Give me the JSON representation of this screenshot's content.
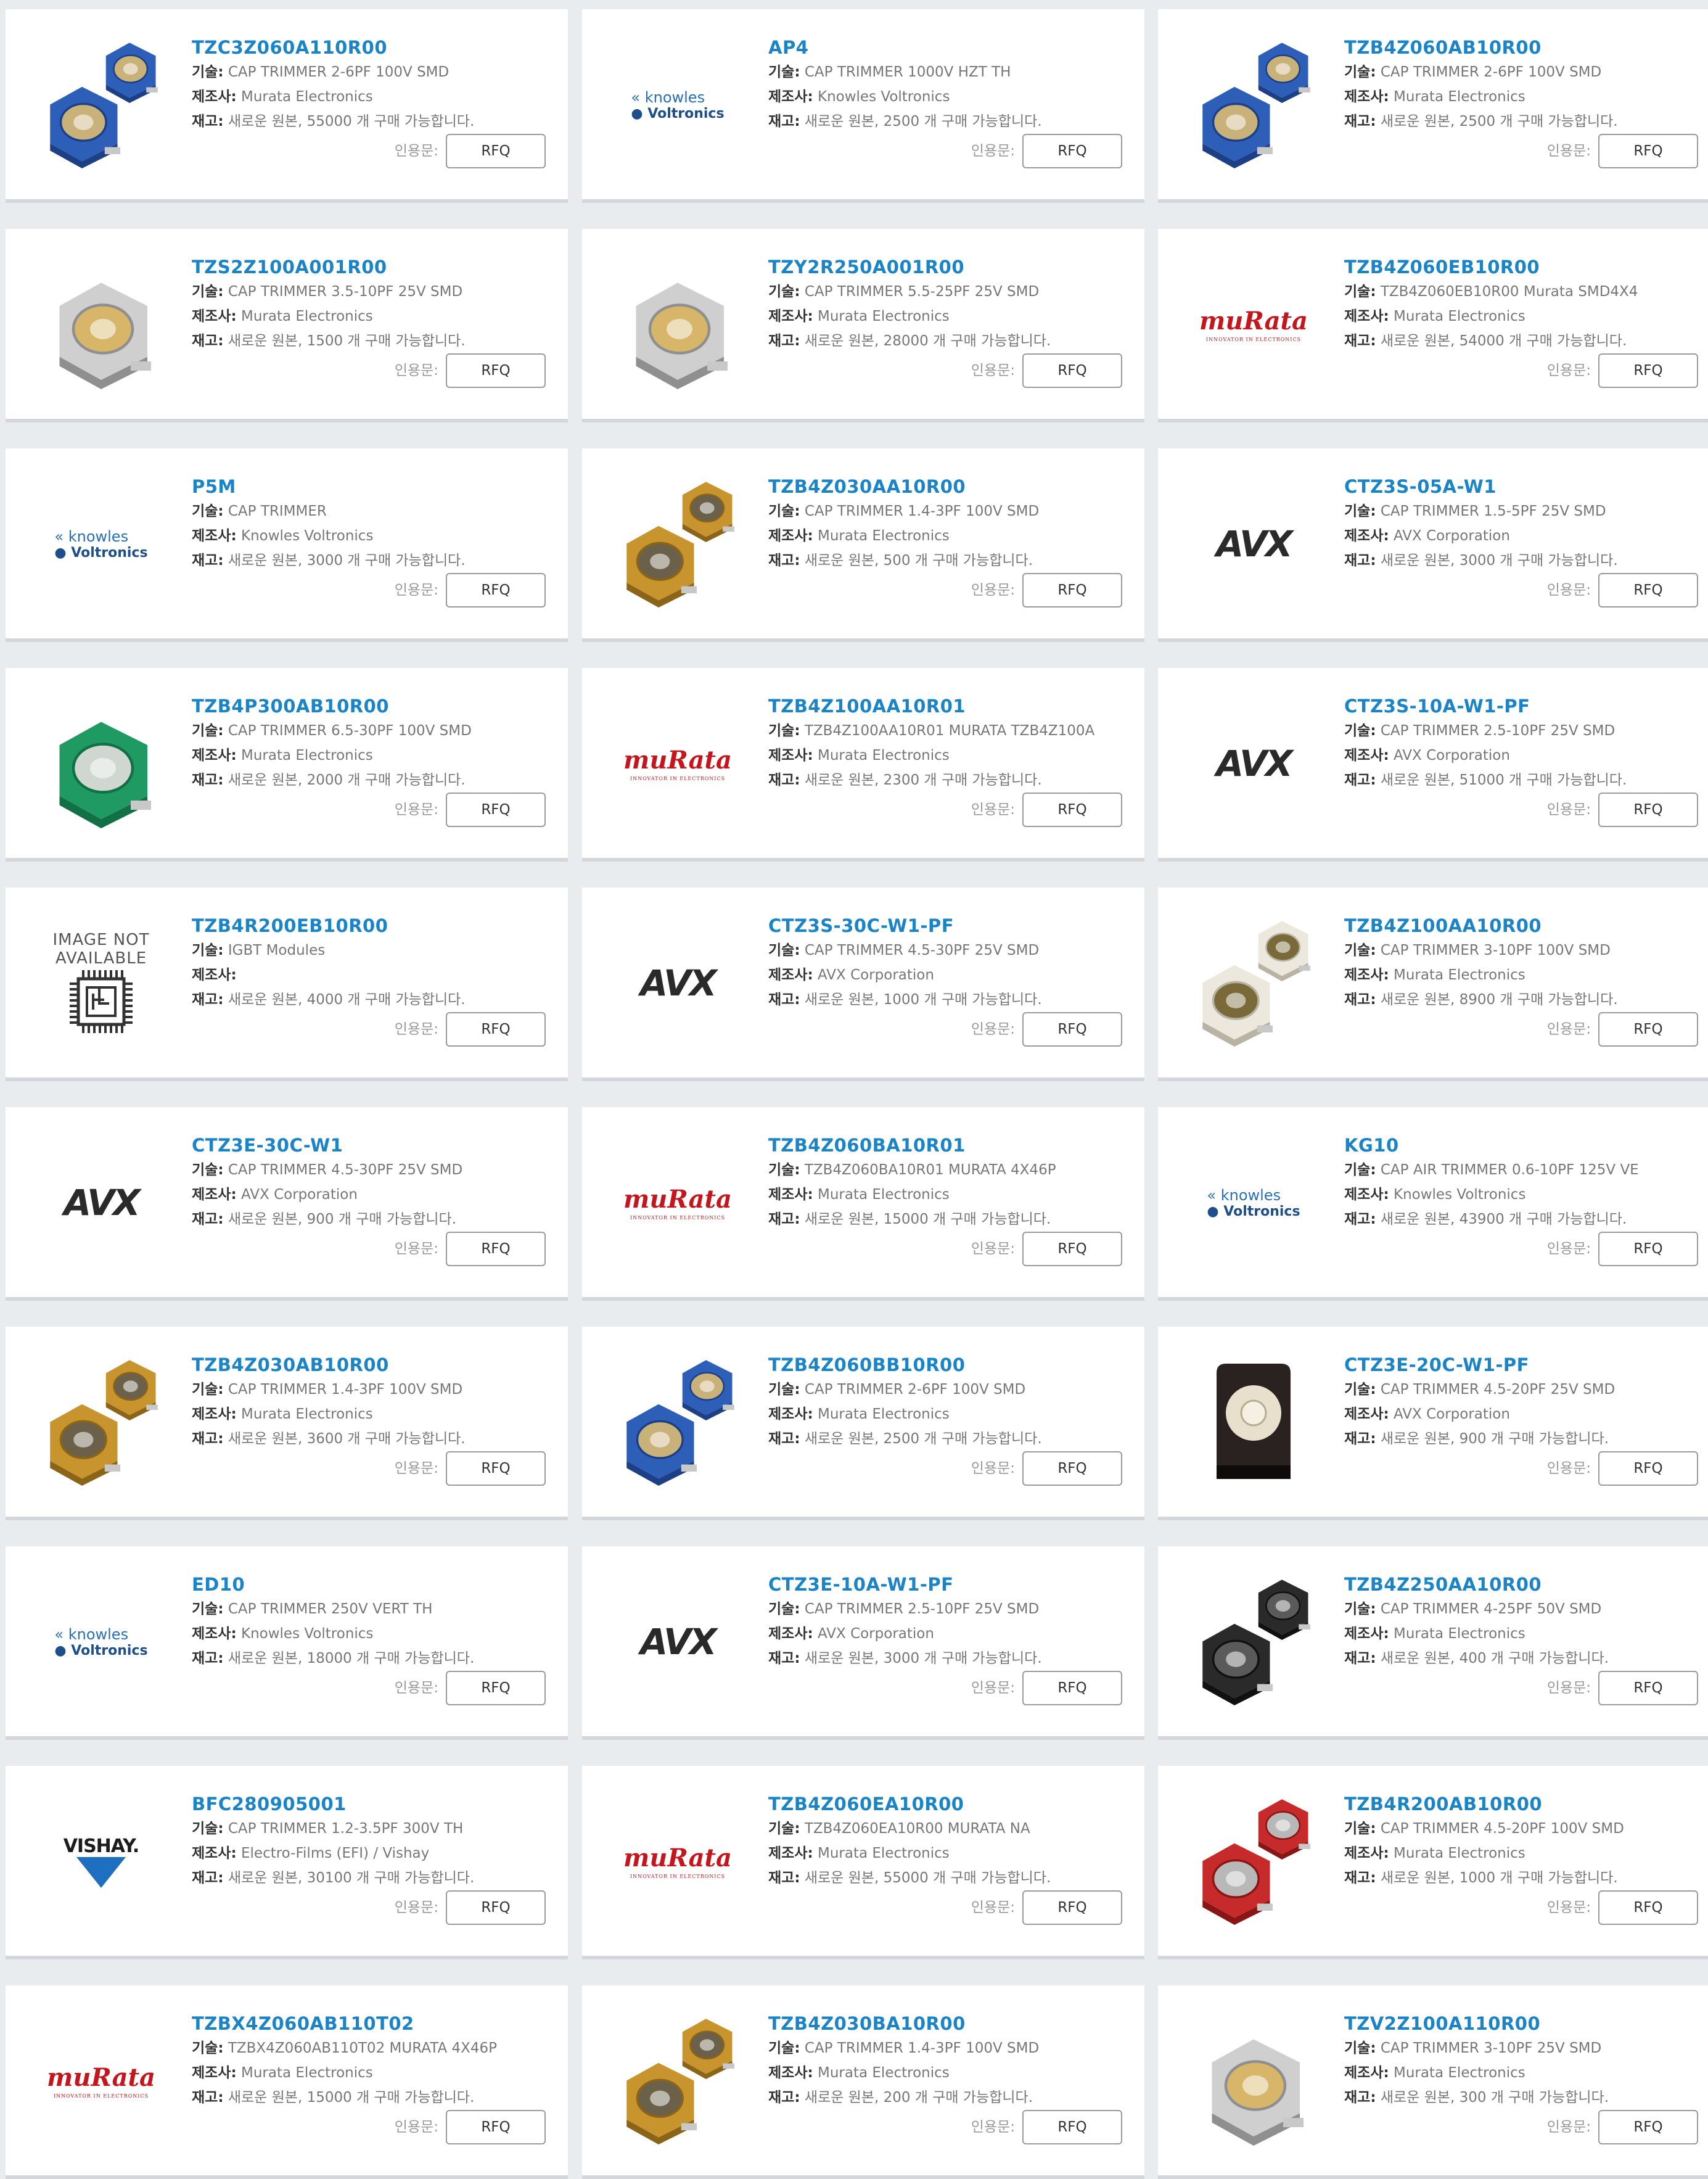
{
  "labels": {
    "tech": "기술:",
    "manufacturer": "제조사:",
    "stock": "재고:",
    "quote": "인용문:",
    "rfq": "RFQ"
  },
  "colors": {
    "part_link": "#1a84c7",
    "murata_red": "#c4161c",
    "avx_black": "#2a2a2a"
  },
  "products": [
    {
      "pn": "TZC3Z060A110R00",
      "tech": "CAP TRIMMER 2-6PF 100V SMD",
      "mfr": "Murata Electronics",
      "stock": "새로운 원본, 55000 개 구매 가능합니다.",
      "image": "trimmer-blue-icon"
    },
    {
      "pn": "AP4",
      "tech": "CAP TRIMMER 1000V HZT TH",
      "mfr": "Knowles Voltronics",
      "stock": "새로운 원본, 2500 개 구매 가능합니다.",
      "image": "knowles-voltronics-logo",
      "logo_text": [
        "knowles",
        "Voltronics"
      ]
    },
    {
      "pn": "TZB4Z060AB10R00",
      "tech": "CAP TRIMMER 2-6PF 100V SMD",
      "mfr": "Murata Electronics",
      "stock": "새로운 원본, 2500 개 구매 가능합니다.",
      "image": "trimmer-blue-icon"
    },
    {
      "pn": "TZS2Z100A001R00",
      "tech": "CAP TRIMMER 3.5-10PF 25V SMD",
      "mfr": "Murata Electronics",
      "stock": "새로운 원본, 1500 개 구매 가능합니다.",
      "image": "trimmer-silver-icon"
    },
    {
      "pn": "TZY2R250A001R00",
      "tech": "CAP TRIMMER 5.5-25PF 25V SMD",
      "mfr": "Murata Electronics",
      "stock": "새로운 원본, 28000 개 구매 가능합니다.",
      "image": "trimmer-silver-icon"
    },
    {
      "pn": "TZB4Z060EB10R00",
      "tech": "TZB4Z060EB10R00 Murata SMD4X4",
      "mfr": "Murata Electronics",
      "stock": "새로운 원본, 54000 개 구매 가능합니다.",
      "image": "murata-logo",
      "logo_text": [
        "muRata",
        "INNOVATOR IN ELECTRONICS"
      ]
    },
    {
      "pn": "P5M",
      "tech": "CAP TRIMMER",
      "mfr": "Knowles Voltronics",
      "stock": "새로운 원본, 3000 개 구매 가능합니다.",
      "image": "knowles-voltronics-logo",
      "logo_text": [
        "knowles",
        "Voltronics"
      ]
    },
    {
      "pn": "TZB4Z030AA10R00",
      "tech": "CAP TRIMMER 1.4-3PF 100V SMD",
      "mfr": "Murata Electronics",
      "stock": "새로운 원본, 500 개 구매 가능합니다.",
      "image": "trimmer-brown-icon"
    },
    {
      "pn": "CTZ3S-05A-W1",
      "tech": "CAP TRIMMER 1.5-5PF 25V SMD",
      "mfr": "AVX Corporation",
      "stock": "새로운 원본, 3000 개 구매 가능합니다.",
      "image": "avx-logo",
      "logo_text": [
        "AVX"
      ]
    },
    {
      "pn": "TZB4P300AB10R00",
      "tech": "CAP TRIMMER 6.5-30PF 100V SMD",
      "mfr": "Murata Electronics",
      "stock": "새로운 원본, 2000 개 구매 가능합니다.",
      "image": "trimmer-green-icon"
    },
    {
      "pn": "TZB4Z100AA10R01",
      "tech": "TZB4Z100AA10R01 MURATA TZB4Z100A",
      "mfr": "Murata Electronics",
      "stock": "새로운 원본, 2300 개 구매 가능합니다.",
      "image": "murata-logo",
      "logo_text": [
        "muRata",
        "INNOVATOR IN ELECTRONICS"
      ]
    },
    {
      "pn": "CTZ3S-10A-W1-PF",
      "tech": "CAP TRIMMER 2.5-10PF 25V SMD",
      "mfr": "AVX Corporation",
      "stock": "새로운 원본, 51000 개 구매 가능합니다.",
      "image": "avx-logo",
      "logo_text": [
        "AVX"
      ]
    },
    {
      "pn": "TZB4R200EB10R00",
      "tech": "IGBT Modules",
      "mfr": "",
      "stock": "새로운 원본, 4000 개 구매 가능합니다.",
      "image": "image-not-available-icon",
      "logo_text": [
        "IMAGE NOT",
        "AVAILABLE"
      ]
    },
    {
      "pn": "CTZ3S-30C-W1-PF",
      "tech": "CAP TRIMMER 4.5-30PF 25V SMD",
      "mfr": "AVX Corporation",
      "stock": "새로운 원본, 1000 개 구매 가능합니다.",
      "image": "avx-logo",
      "logo_text": [
        "AVX"
      ]
    },
    {
      "pn": "TZB4Z100AA10R00",
      "tech": "CAP TRIMMER 3-10PF 100V SMD",
      "mfr": "Murata Electronics",
      "stock": "새로운 원본, 8900 개 구매 가능합니다.",
      "image": "trimmer-white-icon"
    },
    {
      "pn": "CTZ3E-30C-W1",
      "tech": "CAP TRIMMER 4.5-30PF 25V SMD",
      "mfr": "AVX Corporation",
      "stock": "새로운 원본, 900 개 구매 가능합니다.",
      "image": "avx-logo",
      "logo_text": [
        "AVX"
      ]
    },
    {
      "pn": "TZB4Z060BA10R01",
      "tech": "TZB4Z060BA10R01 MURATA 4X46P",
      "mfr": "Murata Electronics",
      "stock": "새로운 원본, 15000 개 구매 가능합니다.",
      "image": "murata-logo",
      "logo_text": [
        "muRata",
        "INNOVATOR IN ELECTRONICS"
      ]
    },
    {
      "pn": "KG10",
      "tech": "CAP AIR TRIMMER 0.6-10PF 125V VE",
      "mfr": "Knowles Voltronics",
      "stock": "새로운 원본, 43900 개 구매 가능합니다.",
      "image": "knowles-voltronics-logo",
      "logo_text": [
        "knowles",
        "Voltronics"
      ]
    },
    {
      "pn": "TZB4Z030AB10R00",
      "tech": "CAP TRIMMER 1.4-3PF 100V SMD",
      "mfr": "Murata Electronics",
      "stock": "새로운 원본, 3600 개 구매 가능합니다.",
      "image": "trimmer-brown-icon"
    },
    {
      "pn": "TZB4Z060BB10R00",
      "tech": "CAP TRIMMER 2-6PF 100V SMD",
      "mfr": "Murata Electronics",
      "stock": "새로운 원본, 2500 개 구매 가능합니다.",
      "image": "trimmer-blue-icon"
    },
    {
      "pn": "CTZ3E-20C-W1-PF",
      "tech": "CAP TRIMMER 4.5-20PF 25V SMD",
      "mfr": "AVX Corporation",
      "stock": "새로운 원본, 900 개 구매 가능합니다.",
      "image": "trimmer-black-tall-icon"
    },
    {
      "pn": "ED10",
      "tech": "CAP TRIMMER 250V VERT TH",
      "mfr": "Knowles Voltronics",
      "stock": "새로운 원본, 18000 개 구매 가능합니다.",
      "image": "knowles-voltronics-logo",
      "logo_text": [
        "knowles",
        "Voltronics"
      ]
    },
    {
      "pn": "CTZ3E-10A-W1-PF",
      "tech": "CAP TRIMMER 2.5-10PF 25V SMD",
      "mfr": "AVX Corporation",
      "stock": "새로운 원본, 3000 개 구매 가능합니다.",
      "image": "avx-logo",
      "logo_text": [
        "AVX"
      ]
    },
    {
      "pn": "TZB4Z250AA10R00",
      "tech": "CAP TRIMMER 4-25PF 50V SMD",
      "mfr": "Murata Electronics",
      "stock": "새로운 원본, 400 개 구매 가능합니다.",
      "image": "trimmer-black-icon"
    },
    {
      "pn": "BFC280905001",
      "tech": "CAP TRIMMER 1.2-3.5PF 300V TH",
      "mfr": "Electro-Films (EFI) / Vishay",
      "stock": "새로운 원본, 30100 개 구매 가능합니다.",
      "image": "vishay-logo",
      "logo_text": [
        "VISHAY."
      ]
    },
    {
      "pn": "TZB4Z060EA10R00",
      "tech": "TZB4Z060EA10R00 MURATA NA",
      "mfr": "Murata Electronics",
      "stock": "새로운 원본, 55000 개 구매 가능합니다.",
      "image": "murata-logo",
      "logo_text": [
        "muRata",
        "INNOVATOR IN ELECTRONICS"
      ]
    },
    {
      "pn": "TZB4R200AB10R00",
      "tech": "CAP TRIMMER 4.5-20PF 100V SMD",
      "mfr": "Murata Electronics",
      "stock": "새로운 원본, 1000 개 구매 가능합니다.",
      "image": "trimmer-red-icon"
    },
    {
      "pn": "TZBX4Z060AB110T02",
      "tech": "TZBX4Z060AB110T02 MURATA 4X46P",
      "mfr": "Murata Electronics",
      "stock": "새로운 원본, 15000 개 구매 가능합니다.",
      "image": "murata-logo",
      "logo_text": [
        "muRata",
        "INNOVATOR IN ELECTRONICS"
      ]
    },
    {
      "pn": "TZB4Z030BA10R00",
      "tech": "CAP TRIMMER 1.4-3PF 100V SMD",
      "mfr": "Murata Electronics",
      "stock": "새로운 원본, 200 개 구매 가능합니다.",
      "image": "trimmer-brown-icon"
    },
    {
      "pn": "TZV2Z100A110R00",
      "tech": "CAP TRIMMER 3-10PF 25V SMD",
      "mfr": "Murata Electronics",
      "stock": "새로운 원본, 300 개 구매 가능합니다.",
      "image": "trimmer-silver-icon"
    }
  ]
}
